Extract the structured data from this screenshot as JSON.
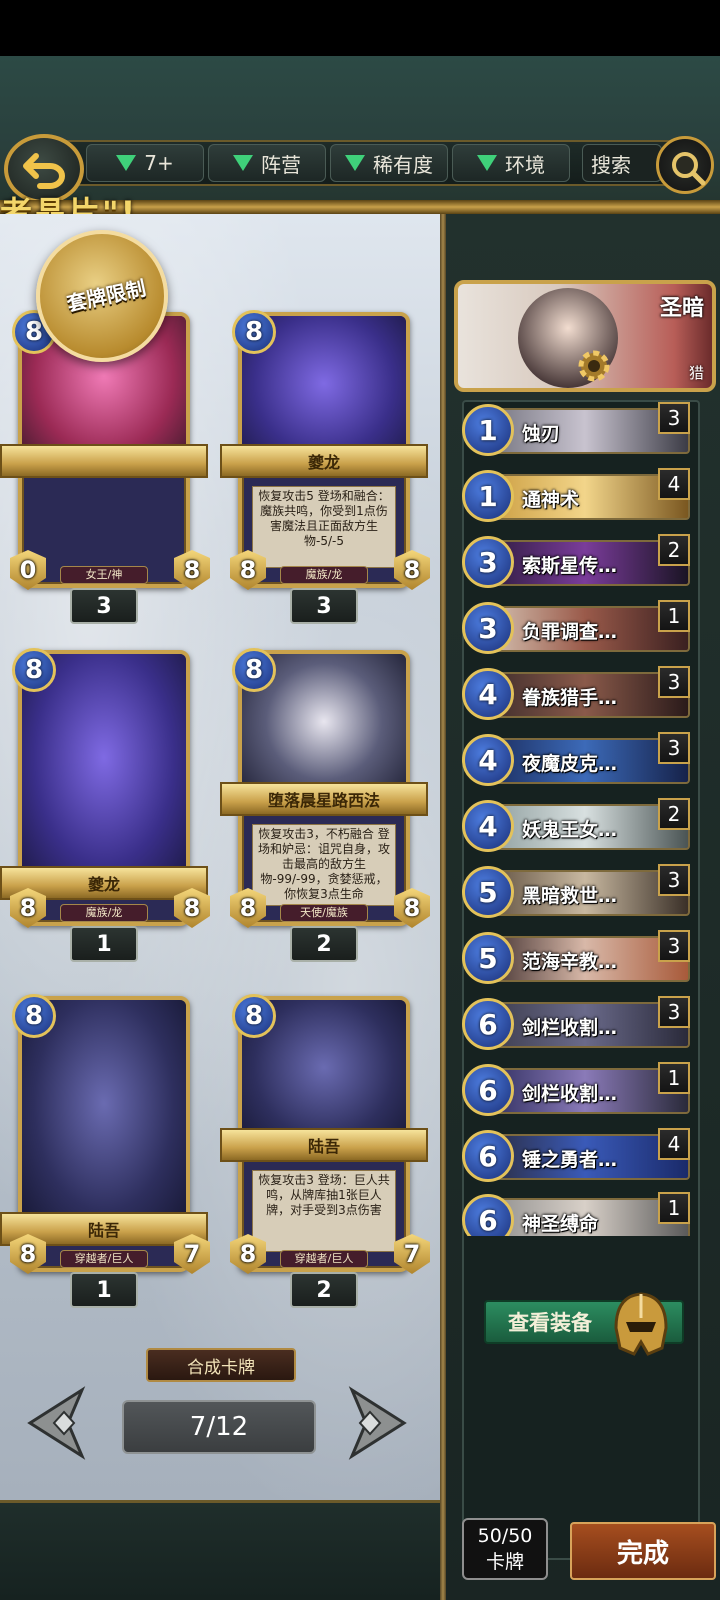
{
  "filters": {
    "cost": "7+",
    "faction": "阵营",
    "rarity": "稀有度",
    "environment": "环境",
    "search": "搜索"
  },
  "banner": "者晶片\"!",
  "cards": [
    {
      "cost": "8",
      "name": "",
      "desc": "",
      "tribe": "女王/神",
      "atk": "0",
      "life": "8",
      "count": "3"
    },
    {
      "cost": "8",
      "name": "夔龙",
      "desc": "恢复攻击5\n登场和融合：魔族共鸣，你受到1点伤害魔法且正面敌方生物-5/-5",
      "tribe": "魔族/龙",
      "atk": "8",
      "life": "8",
      "count": "3"
    },
    {
      "cost": "8",
      "name": "夔龙",
      "desc": "",
      "tribe": "魔族/龙",
      "atk": "8",
      "life": "8",
      "count": "1"
    },
    {
      "cost": "8",
      "name": "堕落晨星路西法",
      "desc": "恢复攻击3，不朽融合\n登场和妒忌：诅咒自身，攻击最高的敌方生物-99/-99，贪婪惩戒，你恢复3点生命",
      "tribe": "天使/魔族",
      "atk": "8",
      "life": "8",
      "count": "2"
    },
    {
      "cost": "8",
      "name": "陆吾",
      "desc": "",
      "tribe": "穿越者/巨人",
      "atk": "8",
      "life": "7",
      "count": "1"
    },
    {
      "cost": "8",
      "name": "陆吾",
      "desc": "恢复攻击3\n登场：巨人共鸣，从牌库抽1张巨人牌，对手受到3点伤害",
      "tribe": "穿越者/巨人",
      "atk": "8",
      "life": "7",
      "count": "2"
    }
  ],
  "seal_text": "套牌限制",
  "synth_label": "合成卡牌",
  "page_indicator": "7/12",
  "leader": {
    "faction": "圣暗",
    "class": "猎"
  },
  "deck": [
    {
      "cost": "1",
      "name": "蚀刃",
      "count": "3"
    },
    {
      "cost": "1",
      "name": "通神术",
      "count": "4"
    },
    {
      "cost": "3",
      "name": "索斯星传…",
      "count": "2"
    },
    {
      "cost": "3",
      "name": "负罪调查…",
      "count": "1"
    },
    {
      "cost": "4",
      "name": "眷族猎手…",
      "count": "3"
    },
    {
      "cost": "4",
      "name": "夜魔皮克…",
      "count": "3"
    },
    {
      "cost": "4",
      "name": "妖鬼王女…",
      "count": "2"
    },
    {
      "cost": "5",
      "name": "黑暗救世…",
      "count": "3"
    },
    {
      "cost": "5",
      "name": "范海辛教…",
      "count": "3"
    },
    {
      "cost": "6",
      "name": "剑栏收割…",
      "count": "3"
    },
    {
      "cost": "6",
      "name": "剑栏收割…",
      "count": "1"
    },
    {
      "cost": "6",
      "name": "锤之勇者…",
      "count": "4"
    },
    {
      "cost": "6",
      "name": "神圣缚命",
      "count": "1"
    }
  ],
  "equip_label": "查看装备",
  "deck_count": {
    "value": "50/50",
    "unit": "卡牌"
  },
  "done_label": "完成",
  "colors": {
    "accent_gold": "#c9a24b",
    "cost_gem": "#2f57b8",
    "equip_green": "#2c8d60",
    "done_orange": "#a64e1f"
  }
}
